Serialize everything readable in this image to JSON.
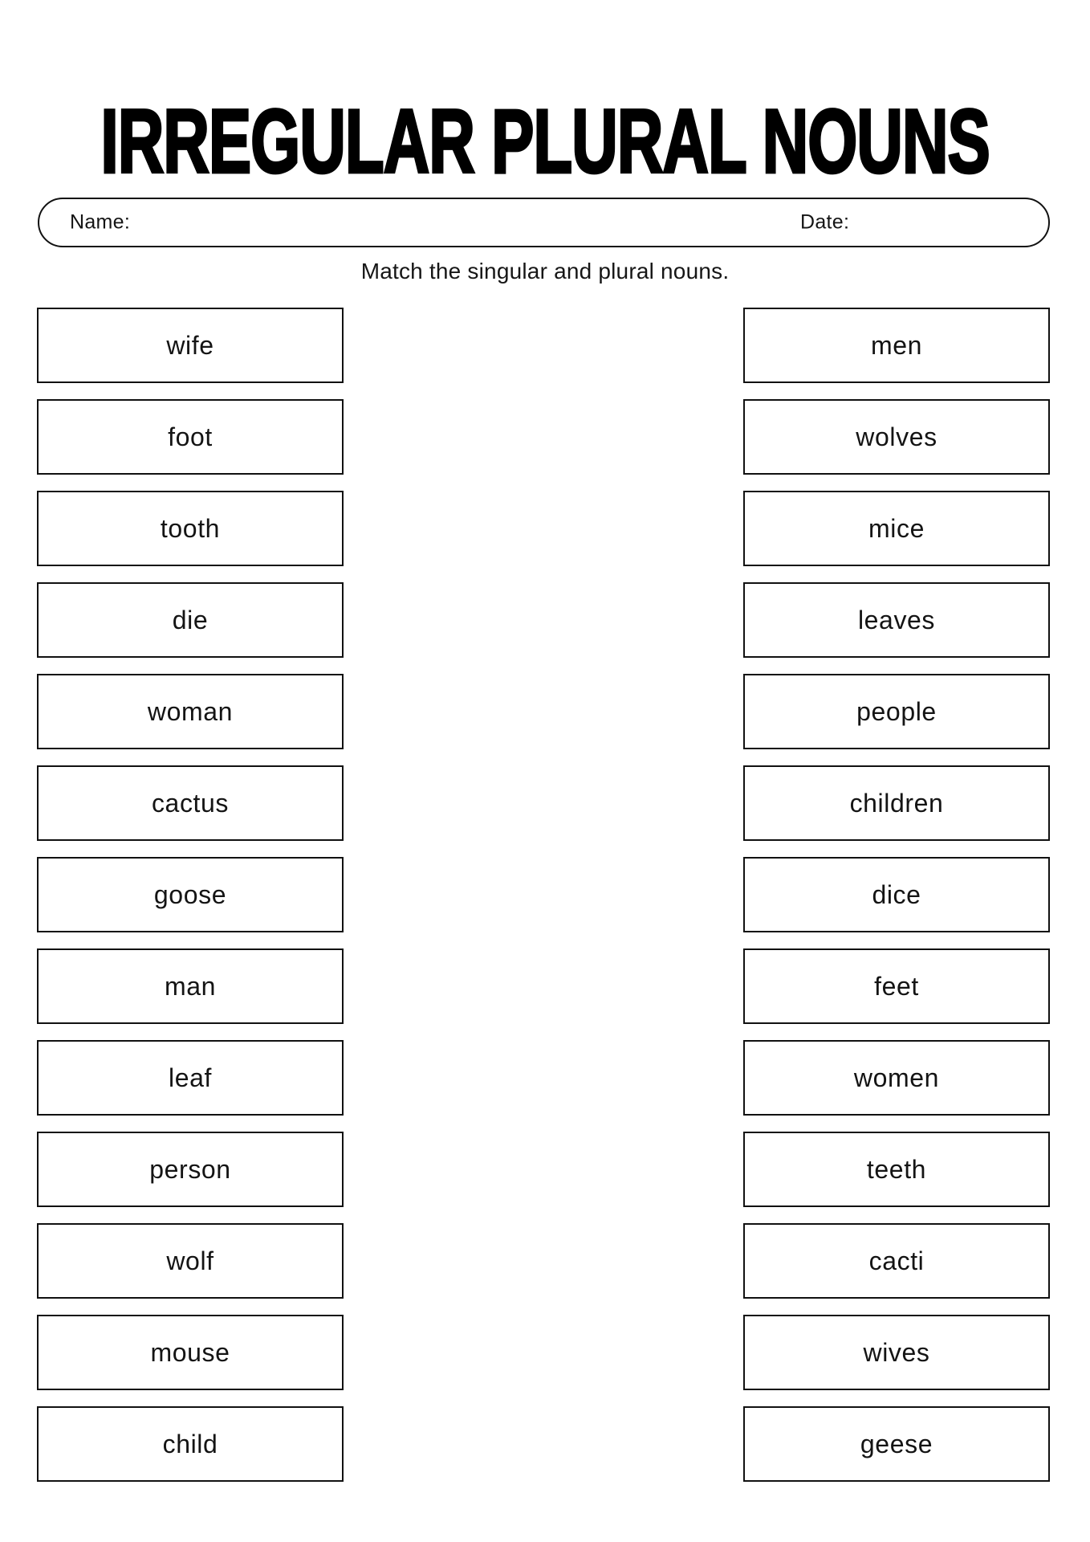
{
  "worksheet": {
    "title": "IRREGULAR PLURAL NOUNS",
    "instruction": "Match the singular and plural nouns.",
    "name_label": "Name:",
    "date_label": "Date:",
    "ink_color": "#111111",
    "background_color": "#ffffff"
  },
  "columns": {
    "singular": [
      {
        "word": "wife"
      },
      {
        "word": "foot"
      },
      {
        "word": "tooth"
      },
      {
        "word": "die"
      },
      {
        "word": "woman"
      },
      {
        "word": "cactus"
      },
      {
        "word": "goose"
      },
      {
        "word": "man"
      },
      {
        "word": "leaf"
      },
      {
        "word": "person"
      },
      {
        "word": "wolf"
      },
      {
        "word": "mouse"
      },
      {
        "word": "child"
      }
    ],
    "plural": [
      {
        "word": "men"
      },
      {
        "word": "wolves"
      },
      {
        "word": "mice"
      },
      {
        "word": "leaves"
      },
      {
        "word": "people"
      },
      {
        "word": "children"
      },
      {
        "word": "dice"
      },
      {
        "word": "feet"
      },
      {
        "word": "women"
      },
      {
        "word": "teeth"
      },
      {
        "word": "cacti"
      },
      {
        "word": "wives"
      },
      {
        "word": "geese"
      }
    ]
  }
}
